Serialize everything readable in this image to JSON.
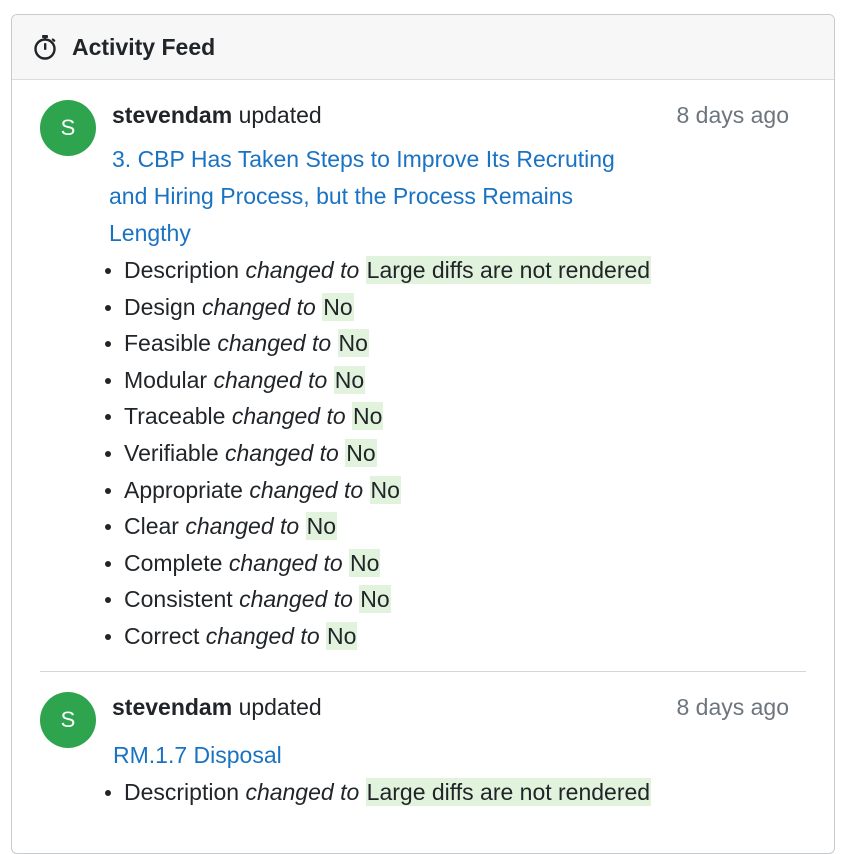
{
  "header": {
    "icon": "stopwatch-icon",
    "title": "Activity Feed"
  },
  "entries": [
    {
      "avatar_letter": "S",
      "avatar_color": "#2ea44f",
      "user": "stevendam",
      "action": "updated",
      "time": "8 days ago",
      "link": "3. CBP Has Taken Steps to Improve Its Recruting and Hiring Process, but the Process Remains Lengthy",
      "changes": [
        {
          "field": "Description",
          "verb": "changed to",
          "value": "Large diffs are not rendered"
        },
        {
          "field": "Design",
          "verb": "changed to",
          "value": "No"
        },
        {
          "field": "Feasible",
          "verb": "changed to",
          "value": "No"
        },
        {
          "field": "Modular",
          "verb": "changed to",
          "value": "No"
        },
        {
          "field": "Traceable",
          "verb": "changed to",
          "value": "No"
        },
        {
          "field": "Verifiable",
          "verb": "changed to",
          "value": "No"
        },
        {
          "field": "Appropriate",
          "verb": "changed to",
          "value": "No"
        },
        {
          "field": "Clear",
          "verb": "changed to",
          "value": "No"
        },
        {
          "field": "Complete",
          "verb": "changed to",
          "value": "No"
        },
        {
          "field": "Consistent",
          "verb": "changed to",
          "value": "No"
        },
        {
          "field": "Correct",
          "verb": "changed to",
          "value": "No"
        }
      ]
    },
    {
      "avatar_letter": "S",
      "avatar_color": "#2ea44f",
      "user": "stevendam",
      "action": "updated",
      "time": "8 days ago",
      "link": "RM.1.7 Disposal",
      "changes": [
        {
          "field": "Description",
          "verb": "changed to",
          "value": "Large diffs are not rendered"
        }
      ]
    }
  ],
  "colors": {
    "link": "#1a73c2",
    "diff_highlight": "#e1f3dc",
    "avatar": "#2ea44f",
    "muted_text": "#6c757d"
  }
}
